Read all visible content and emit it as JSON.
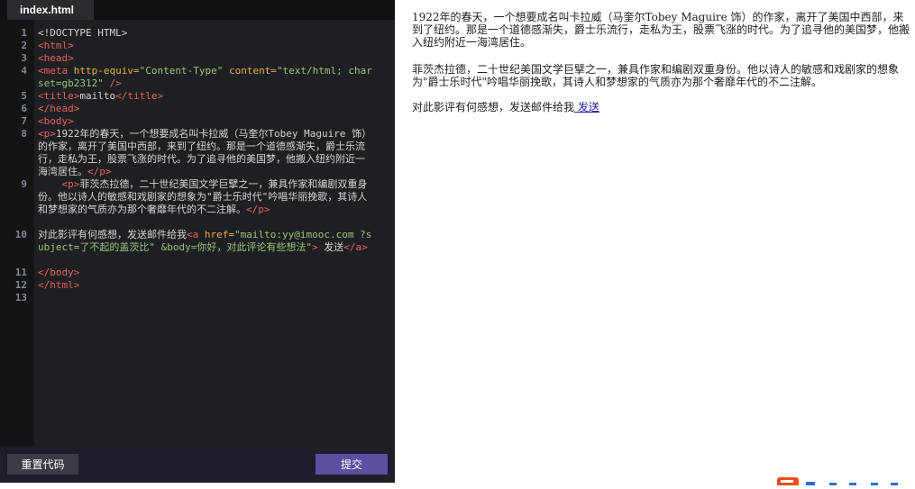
{
  "editor": {
    "tab_label": "index.html",
    "lines": [
      {
        "n": "1",
        "segs": [
          {
            "c": "#d4d4d4",
            "t": "<!DOCTYPE HTML>"
          }
        ]
      },
      {
        "n": "2",
        "segs": [
          {
            "c": "#e06060",
            "t": "<html>"
          }
        ]
      },
      {
        "n": "3",
        "segs": [
          {
            "c": "#e06060",
            "t": "<head>"
          }
        ]
      },
      {
        "n": "4",
        "segs": [
          {
            "c": "#e06060",
            "t": "<meta "
          },
          {
            "c": "#e0b040",
            "t": "http-equiv="
          },
          {
            "c": "#98c379",
            "t": "\"Content-Type\""
          },
          {
            "c": "#e0b040",
            "t": " content="
          },
          {
            "c": "#98c379",
            "t": "\"text/html; charset=gb2312\""
          },
          {
            "c": "#e06060",
            "t": " />"
          }
        ]
      },
      {
        "n": "5",
        "segs": [
          {
            "c": "#e06060",
            "t": "<title>"
          },
          {
            "c": "#d4d4d4",
            "t": "mailto"
          },
          {
            "c": "#e06060",
            "t": "</title>"
          }
        ]
      },
      {
        "n": "6",
        "segs": [
          {
            "c": "#e06060",
            "t": "</head>"
          }
        ]
      },
      {
        "n": "7",
        "segs": [
          {
            "c": "#e06060",
            "t": "<body>"
          }
        ]
      },
      {
        "n": "8",
        "segs": [
          {
            "c": "#e06060",
            "t": "<p>"
          },
          {
            "c": "#d4d4d4",
            "t": "1922年的春天，一个想要成名叫卡拉威（马奎尔Tobey Maguire 饰）的作家，离开了美国中西部，来到了纽约。那是一个道德感渐失，爵士乐流行，走私为王，股票飞涨的时代。为了追寻他的美国梦，他搬入纽约附近一海湾居住。"
          },
          {
            "c": "#e06060",
            "t": "</p>"
          }
        ]
      },
      {
        "n": "9",
        "segs": [
          {
            "c": "#d4d4d4",
            "t": "    "
          },
          {
            "c": "#e06060",
            "t": "<p>"
          },
          {
            "c": "#d4d4d4",
            "t": "菲茨杰拉德，二十世纪美国文学巨擘之一，兼具作家和编剧双重身份。他以诗人的敏感和戏剧家的想象为\"爵士乐时代\"吟唱华丽挽歌，其诗人和梦想家的气质亦为那个奢靡年代的不二注解。"
          },
          {
            "c": "#e06060",
            "t": "</p>"
          }
        ]
      },
      {
        "n": "10",
        "segs": [
          {
            "c": "#d4d4d4",
            "t": "对此影评有何感想，发送邮件给我"
          },
          {
            "c": "#e06060",
            "t": "<a "
          },
          {
            "c": "#e0b040",
            "t": "href="
          },
          {
            "c": "#98c379",
            "t": "\"mailto:yy@imooc.com ?subject=了不起的盖茨比\" &body=你好，对此评论有些想法\""
          },
          {
            "c": "#e06060",
            "t": ">"
          },
          {
            "c": "#d4d4d4",
            "t": " 发送"
          },
          {
            "c": "#e06060",
            "t": "</a>"
          }
        ]
      },
      {
        "n": "11",
        "segs": [
          {
            "c": "#e06060",
            "t": "</body>"
          }
        ]
      },
      {
        "n": "12",
        "segs": [
          {
            "c": "#e06060",
            "t": "</html>"
          }
        ]
      },
      {
        "n": "13",
        "segs": []
      }
    ]
  },
  "footer": {
    "reset_label": "重置代码",
    "submit_label": "提交"
  },
  "preview": {
    "p1": "1922年的春天，一个想要成名叫卡拉威（马奎尔Tobey Maguire 饰）的作家，离开了美国中西部，来到了纽约。那是一个道德感渐失，爵士乐流行，走私为王，股票飞涨的时代。为了追寻他的美国梦，他搬入纽约附近一海湾居住。",
    "p2": "菲茨杰拉德，二十世纪美国文学巨擘之一，兼具作家和编剧双重身份。他以诗人的敏感和戏剧家的想象为\"爵士乐时代\"吟唱华丽挽歌，其诗人和梦想家的气质亦为那个奢靡年代的不二注解。",
    "p3_text": "对此影评有何感想，发送邮件给我",
    "p3_link": " 发送"
  },
  "colors": {
    "editor_bg": "#1e1f22",
    "tag": "#e06060",
    "attr": "#e0b040",
    "string": "#98c379",
    "submit": "#5a4fa0"
  }
}
